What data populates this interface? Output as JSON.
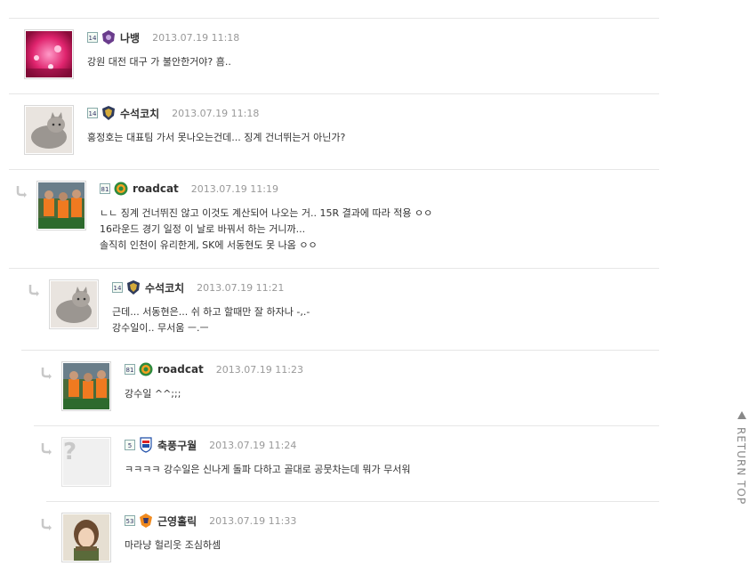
{
  "top_fragment": "··· ··· ···",
  "comments": [
    {
      "level": "14",
      "nickname": "나뱅",
      "date": "2013.07.19 11:18",
      "lines": [
        "강원 대전 대구 가 불안한거야? 흠.."
      ],
      "avatar": "pink-stadium",
      "team": "purple-crest"
    },
    {
      "level": "14",
      "nickname": "수석코치",
      "date": "2013.07.19 11:18",
      "lines": [
        "홍정호는 대표팀 가서 못나오는건데... 징계 건너뛰는거 아닌가?"
      ],
      "avatar": "cat",
      "team": "gold-crest"
    },
    {
      "level": "81",
      "nickname": "roadcat",
      "date": "2013.07.19 11:19",
      "lines": [
        "ㄴㄴ 징계 건너뛰진 않고 이것도 계산되어 나오는 거.. 15R 결과에 따라 적용 ㅇㅇ",
        "16라운드 경기 일정 이 날로 바꿔서 하는 거니까...",
        "솔직히 인천이 유리한게, SK에 서동현도 못 나옴 ㅇㅇ"
      ],
      "avatar": "players",
      "team": "green-crest"
    },
    {
      "level": "14",
      "nickname": "수석코치",
      "date": "2013.07.19 11:21",
      "lines": [
        "근데... 서동현은... 쉬 하고 할때만 잘 하자나 -,.-",
        "강수일이.. 무서움 ㅡ.ㅡ"
      ],
      "avatar": "cat",
      "team": "gold-crest"
    },
    {
      "level": "81",
      "nickname": "roadcat",
      "date": "2013.07.19 11:23",
      "lines": [
        "강수일 ^^;;;"
      ],
      "avatar": "players",
      "team": "green-crest"
    },
    {
      "level": "5",
      "nickname": "축풍구월",
      "date": "2013.07.19 11:24",
      "lines": [
        "ㅋㅋㅋㅋ 강수일은 신나게 돌파 다하고 골대로 공뭇차는데 뭐가 무서워"
      ],
      "avatar": "unknown",
      "team": "blue-crest"
    },
    {
      "level": "53",
      "nickname": "근영홀릭",
      "date": "2013.07.19 11:33",
      "lines": [
        "마라냥 헐리웃 조심하셈"
      ],
      "avatar": "person",
      "team": "orange-crest"
    }
  ],
  "return_top": "RETURN TOP",
  "colors": {
    "divider": "#e6e6e6",
    "date": "#999999",
    "nick": "#333333"
  }
}
